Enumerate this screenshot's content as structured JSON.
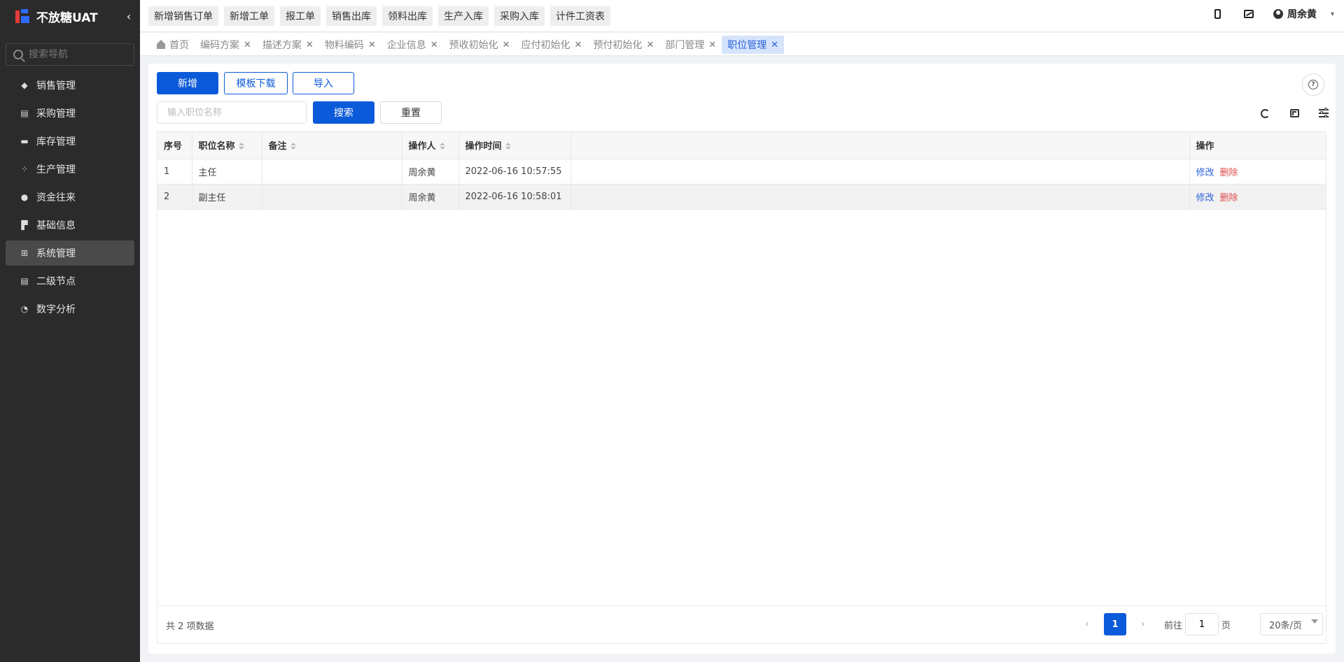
{
  "app": {
    "title": "不放糖UAT",
    "collapse_icon": "chevron-left-icon"
  },
  "sidebar": {
    "search_placeholder": "搜索导航",
    "items": [
      {
        "label": "销售管理",
        "icon": "tag-icon",
        "active": false
      },
      {
        "label": "采购管理",
        "icon": "cart-icon",
        "active": false
      },
      {
        "label": "库存管理",
        "icon": "box-icon",
        "active": false
      },
      {
        "label": "生产管理",
        "icon": "cluster-icon",
        "active": false
      },
      {
        "label": "资金往来",
        "icon": "money-icon",
        "active": false
      },
      {
        "label": "基础信息",
        "icon": "layout-icon",
        "active": false
      },
      {
        "label": "系统管理",
        "icon": "grid-icon",
        "active": true
      },
      {
        "label": "二级节点",
        "icon": "list-icon",
        "active": false
      },
      {
        "label": "数字分析",
        "icon": "pie-icon",
        "active": false
      }
    ]
  },
  "topbar": {
    "quick_buttons": [
      "新增销售订单",
      "新增工单",
      "报工单",
      "销售出库",
      "领料出库",
      "生产入库",
      "采购入库",
      "计件工资表"
    ],
    "user_name": "周余黄"
  },
  "tabs": [
    {
      "label": "首页",
      "closable": false,
      "active": false
    },
    {
      "label": "编码方案",
      "closable": true,
      "active": false
    },
    {
      "label": "描述方案",
      "closable": true,
      "active": false
    },
    {
      "label": "物料编码",
      "closable": true,
      "active": false
    },
    {
      "label": "企业信息",
      "closable": true,
      "active": false
    },
    {
      "label": "预收初始化",
      "closable": true,
      "active": false
    },
    {
      "label": "应付初始化",
      "closable": true,
      "active": false
    },
    {
      "label": "预付初始化",
      "closable": true,
      "active": false
    },
    {
      "label": "部门管理",
      "closable": true,
      "active": false
    },
    {
      "label": "职位管理",
      "closable": true,
      "active": true
    }
  ],
  "toolbar": {
    "add_label": "新增",
    "template_label": "模板下载",
    "import_label": "导入",
    "search_placeholder": "输入职位名称",
    "search_label": "搜索",
    "reset_label": "重置",
    "help_glyph": "?"
  },
  "table": {
    "columns": [
      "序号",
      "职位名称",
      "备注",
      "操作人",
      "操作时间",
      "",
      "操作"
    ],
    "rows": [
      {
        "index": "1",
        "name": "主任",
        "remark": "",
        "operator": "周余黄",
        "time": "2022-06-16 10:57:55"
      },
      {
        "index": "2",
        "name": "副主任",
        "remark": "",
        "operator": "周余黄",
        "time": "2022-06-16 10:58:01"
      }
    ],
    "edit_label": "修改",
    "delete_label": "删除"
  },
  "pagination": {
    "total_text": "共 2 项数据",
    "current_page": "1",
    "goto_label": "前往",
    "goto_value": "1",
    "page_unit": "页",
    "page_size": "20条/页"
  },
  "colors": {
    "primary": "#0b5ad9",
    "sidebar_bg": "#2b2b2b",
    "danger": "#e04b4b",
    "tab_active_bg": "#d6e4fb"
  }
}
